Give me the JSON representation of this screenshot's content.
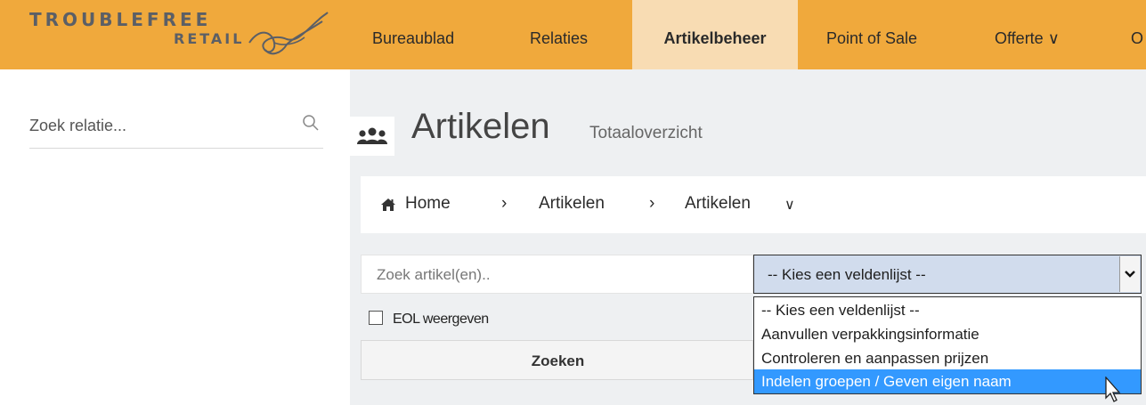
{
  "brand": {
    "line1": "TROUBLEFREE",
    "line2": "RETAIL"
  },
  "nav": {
    "items": [
      {
        "label": "Bureaublad"
      },
      {
        "label": "Relaties"
      },
      {
        "label": "Artikelbeheer",
        "active": true
      },
      {
        "label": "Point of Sale"
      },
      {
        "label": "Offerte ∨"
      },
      {
        "label": "O"
      }
    ]
  },
  "sidebar": {
    "search_placeholder": "Zoek relatie..."
  },
  "page": {
    "title": "Artikelen",
    "subtitle": "Totaaloverzicht"
  },
  "breadcrumb": {
    "home": "Home",
    "sep": "›",
    "level1": "Artikelen",
    "level2": "Artikelen",
    "dropdown_glyph": "∨"
  },
  "filters": {
    "search_placeholder": "Zoek artikel(en)..",
    "fieldlist_value": "-- Kies een veldenlijst --",
    "fieldlist_options": [
      "-- Kies een veldenlijst --",
      "Aanvullen verpakkingsinformatie",
      "Controleren en aanpassen prijzen",
      "Indelen groepen / Geven eigen naam"
    ],
    "highlighted_option_index": 3,
    "eol_label": "EOL weergeven",
    "eol_checked": false,
    "search_button": "Zoeken"
  },
  "colors": {
    "topbar": "#f0a93c",
    "active_tab": "#f8dcb3",
    "content_bg": "#eef0f2",
    "select_bg": "#d1dced",
    "highlight": "#3399ff"
  }
}
